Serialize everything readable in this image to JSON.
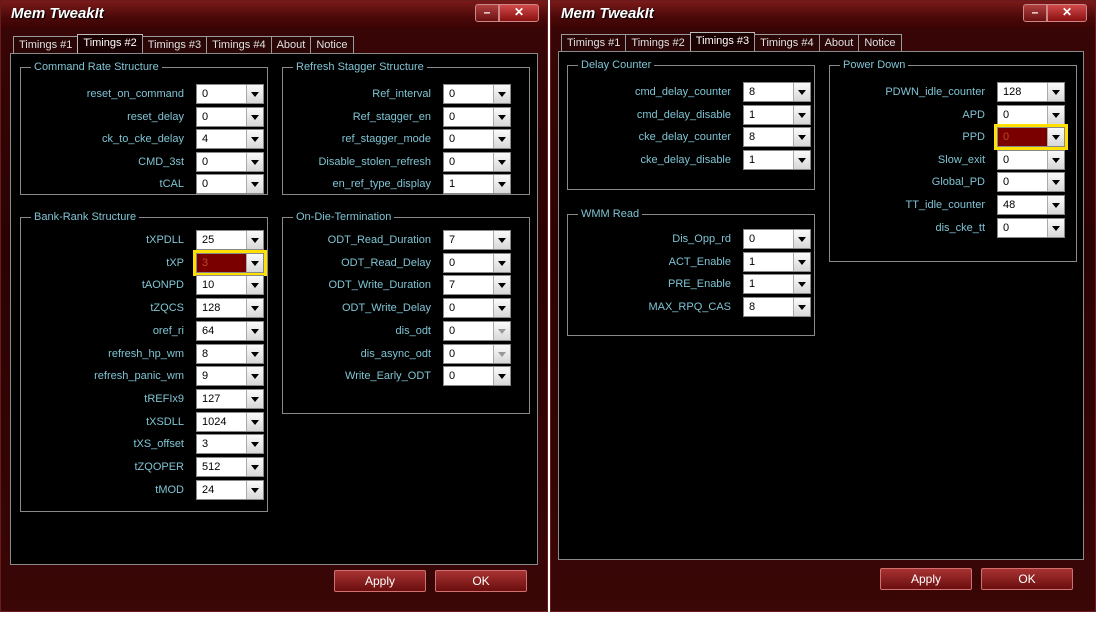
{
  "windows": [
    {
      "title": "Mem TweakIt",
      "tabs": [
        "Timings #1",
        "Timings #2",
        "Timings #3",
        "Timings #4",
        "About",
        "Notice"
      ],
      "active_tab": 1,
      "groups": [
        {
          "title": "Command Rate Structure",
          "fields": [
            {
              "label": "reset_on_command",
              "value": "0"
            },
            {
              "label": "reset_delay",
              "value": "0"
            },
            {
              "label": "ck_to_cke_delay",
              "value": "4"
            },
            {
              "label": "CMD_3st",
              "value": "0"
            },
            {
              "label": "tCAL",
              "value": "0"
            }
          ]
        },
        {
          "title": "Refresh Stagger Structure",
          "fields": [
            {
              "label": "Ref_interval",
              "value": "0"
            },
            {
              "label": "Ref_stagger_en",
              "value": "0"
            },
            {
              "label": "ref_stagger_mode",
              "value": "0"
            },
            {
              "label": "Disable_stolen_refresh",
              "value": "0"
            },
            {
              "label": "en_ref_type_display",
              "value": "1"
            }
          ]
        },
        {
          "title": "Bank-Rank Structure",
          "fields": [
            {
              "label": "tXPDLL",
              "value": "25"
            },
            {
              "label": "tXP",
              "value": "3",
              "highlight": true
            },
            {
              "label": "tAONPD",
              "value": "10"
            },
            {
              "label": "tZQCS",
              "value": "128"
            },
            {
              "label": "oref_ri",
              "value": "64"
            },
            {
              "label": "refresh_hp_wm",
              "value": "8"
            },
            {
              "label": "refresh_panic_wm",
              "value": "9"
            },
            {
              "label": "tREFIx9",
              "value": "127"
            },
            {
              "label": "tXSDLL",
              "value": "1024"
            },
            {
              "label": "tXS_offset",
              "value": "3"
            },
            {
              "label": "tZQOPER",
              "value": "512"
            },
            {
              "label": "tMOD",
              "value": "24"
            }
          ]
        },
        {
          "title": "On-Die-Termination",
          "fields": [
            {
              "label": "ODT_Read_Duration",
              "value": "7"
            },
            {
              "label": "ODT_Read_Delay",
              "value": "0"
            },
            {
              "label": "ODT_Write_Duration",
              "value": "7"
            },
            {
              "label": "ODT_Write_Delay",
              "value": "0"
            },
            {
              "label": "dis_odt",
              "value": "0",
              "disabled": true
            },
            {
              "label": "dis_async_odt",
              "value": "0",
              "disabled": true
            },
            {
              "label": "Write_Early_ODT",
              "value": "0"
            }
          ]
        }
      ],
      "buttons": {
        "apply": "Apply",
        "ok": "OK"
      }
    },
    {
      "title": "Mem TweakIt",
      "tabs": [
        "Timings #1",
        "Timings #2",
        "Timings #3",
        "Timings #4",
        "About",
        "Notice"
      ],
      "active_tab": 2,
      "groups": [
        {
          "title": "Delay Counter",
          "fields": [
            {
              "label": "cmd_delay_counter",
              "value": "8"
            },
            {
              "label": "cmd_delay_disable",
              "value": "1"
            },
            {
              "label": "cke_delay_counter",
              "value": "8"
            },
            {
              "label": "cke_delay_disable",
              "value": "1"
            }
          ]
        },
        {
          "title": "Power Down",
          "fields": [
            {
              "label": "PDWN_idle_counter",
              "value": "128"
            },
            {
              "label": "APD",
              "value": "0"
            },
            {
              "label": "PPD",
              "value": "0",
              "highlight": true
            },
            {
              "label": "Slow_exit",
              "value": "0"
            },
            {
              "label": "Global_PD",
              "value": "0"
            },
            {
              "label": "TT_idle_counter",
              "value": "48"
            },
            {
              "label": "dis_cke_tt",
              "value": "0"
            }
          ]
        },
        {
          "title": "WMM Read",
          "fields": [
            {
              "label": "Dis_Opp_rd",
              "value": "0"
            },
            {
              "label": "ACT_Enable",
              "value": "1"
            },
            {
              "label": "PRE_Enable",
              "value": "1"
            },
            {
              "label": "MAX_RPQ_CAS",
              "value": "8"
            }
          ]
        }
      ],
      "buttons": {
        "apply": "Apply",
        "ok": "OK"
      }
    }
  ]
}
